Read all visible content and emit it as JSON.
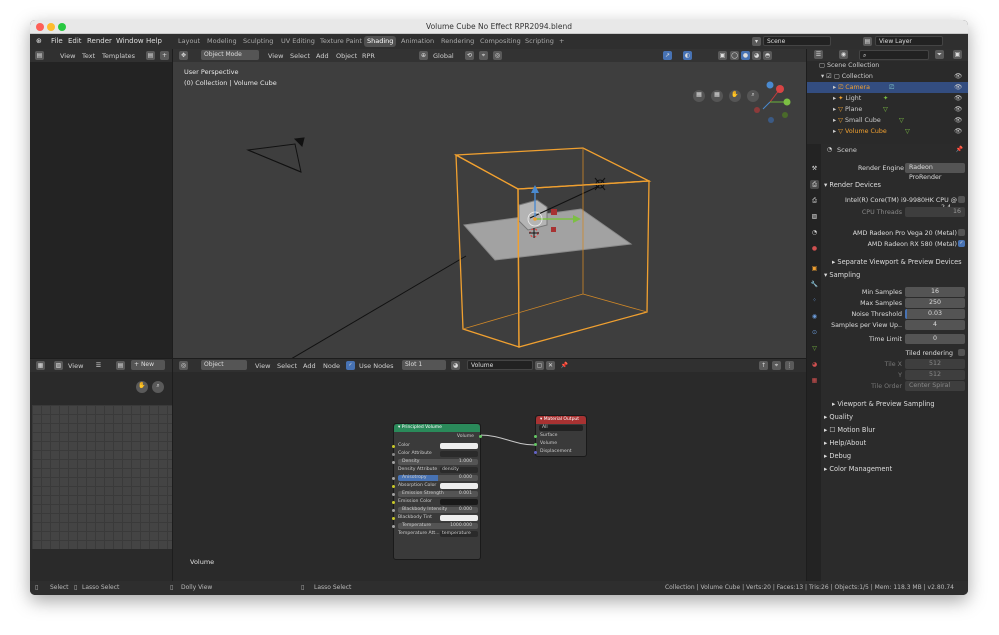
{
  "window": {
    "title": "Volume Cube No Effect RPR2094.blend"
  },
  "menu": {
    "items": [
      "File",
      "Edit",
      "Render",
      "Window",
      "Help"
    ]
  },
  "workspaces": [
    {
      "label": "Layout"
    },
    {
      "label": "Modeling"
    },
    {
      "label": "Sculpting"
    },
    {
      "label": "UV Editing"
    },
    {
      "label": "Texture Paint"
    },
    {
      "label": "Shading",
      "active": true
    },
    {
      "label": "Animation"
    },
    {
      "label": "Rendering"
    },
    {
      "label": "Compositing"
    },
    {
      "label": "Scripting"
    }
  ],
  "topright": {
    "scene": "Scene",
    "view_layer": "View Layer"
  },
  "left_header": {
    "view": "View",
    "text": "Text",
    "templates": "Templates"
  },
  "viewport": {
    "mode": "Object Mode",
    "menus": [
      "View",
      "Select",
      "Add",
      "Object",
      "RPR"
    ],
    "orientation": "Global",
    "info_line1": "User Perspective",
    "info_line2": "(0) Collection | Volume Cube"
  },
  "outliner": {
    "root": "Scene Collection",
    "collection": "Collection",
    "items": [
      {
        "name": "Camera",
        "selected": true
      },
      {
        "name": "Light"
      },
      {
        "name": "Plane"
      },
      {
        "name": "Small Cube"
      },
      {
        "name": "Volume Cube",
        "highlight": true
      }
    ]
  },
  "properties": {
    "scene_label": "Scene",
    "render_engine_label": "Render Engine",
    "render_engine": "Radeon ProRender",
    "render_devices": "Render Devices",
    "cpu": "Intel(R) Core(TM) i9-9980HK CPU @ 2.4...",
    "cpu_threads_label": "CPU Threads",
    "cpu_threads": "16",
    "gpu1": "AMD Radeon Pro Vega 20 (Metal)",
    "gpu2": "AMD Radeon RX 580 (Metal)",
    "separate": "Separate Viewport & Preview Devices",
    "sampling": "Sampling",
    "min_samples_label": "Min Samples",
    "min_samples": "16",
    "max_samples_label": "Max Samples",
    "max_samples": "250",
    "noise_label": "Noise Threshold",
    "noise": "0.03",
    "spvu_label": "Samples per View Up..",
    "spvu": "4",
    "time_limit_label": "Time Limit",
    "time_limit": "0",
    "tiled": "Tiled rendering",
    "tile_x_label": "Tile X",
    "tile_x": "512",
    "tile_y_label": "Y",
    "tile_y": "512",
    "tile_order_label": "Tile Order",
    "tile_order": "Center Spiral",
    "vp_sampling": "Viewport & Preview Sampling",
    "quality": "Quality",
    "motion_blur": "Motion Blur",
    "help": "Help/About",
    "debug": "Debug",
    "color_mgmt": "Color Management"
  },
  "image_editor": {
    "view": "View",
    "new": "New"
  },
  "node_editor": {
    "object": "Object",
    "menus": [
      "View",
      "Select",
      "Add",
      "Node"
    ],
    "use_nodes": "Use Nodes",
    "slot": "Slot 1",
    "material": "Volume",
    "footer_label": "Volume",
    "principled": {
      "title": "Principled Volume",
      "output": "Volume",
      "rows": [
        {
          "label": "Color"
        },
        {
          "label": "Color Attribute"
        },
        {
          "label": "Density",
          "value": "1.000"
        },
        {
          "label": "Density Attribute",
          "value": "density"
        },
        {
          "label": "Anisotropy",
          "value": "0.000"
        },
        {
          "label": "Absorption Color"
        },
        {
          "label": "Emission Strength",
          "value": "0.001"
        },
        {
          "label": "Emission Color"
        },
        {
          "label": "Blackbody Intensity",
          "value": "0.000"
        },
        {
          "label": "Blackbody Tint"
        },
        {
          "label": "Temperature",
          "value": "1000.000"
        },
        {
          "label": "Temperature Att...",
          "value": "temperature"
        }
      ]
    },
    "output": {
      "title": "Material Output",
      "target": "All",
      "sockets": [
        "Surface",
        "Volume",
        "Displacement"
      ]
    }
  },
  "status": {
    "select": "Select",
    "lasso": "Lasso Select",
    "dolly": "Dolly View",
    "lasso2": "Lasso Select",
    "info": "Collection | Volume Cube | Verts:20 | Faces:13 | Tris:26 | Objects:1/5 | Mem: 118.3 MB | v2.80.74"
  },
  "colors": {
    "accent": "#4772b3",
    "active_object": "#f0a030",
    "node_green": "#2a8a5a",
    "node_red": "#a83232"
  }
}
